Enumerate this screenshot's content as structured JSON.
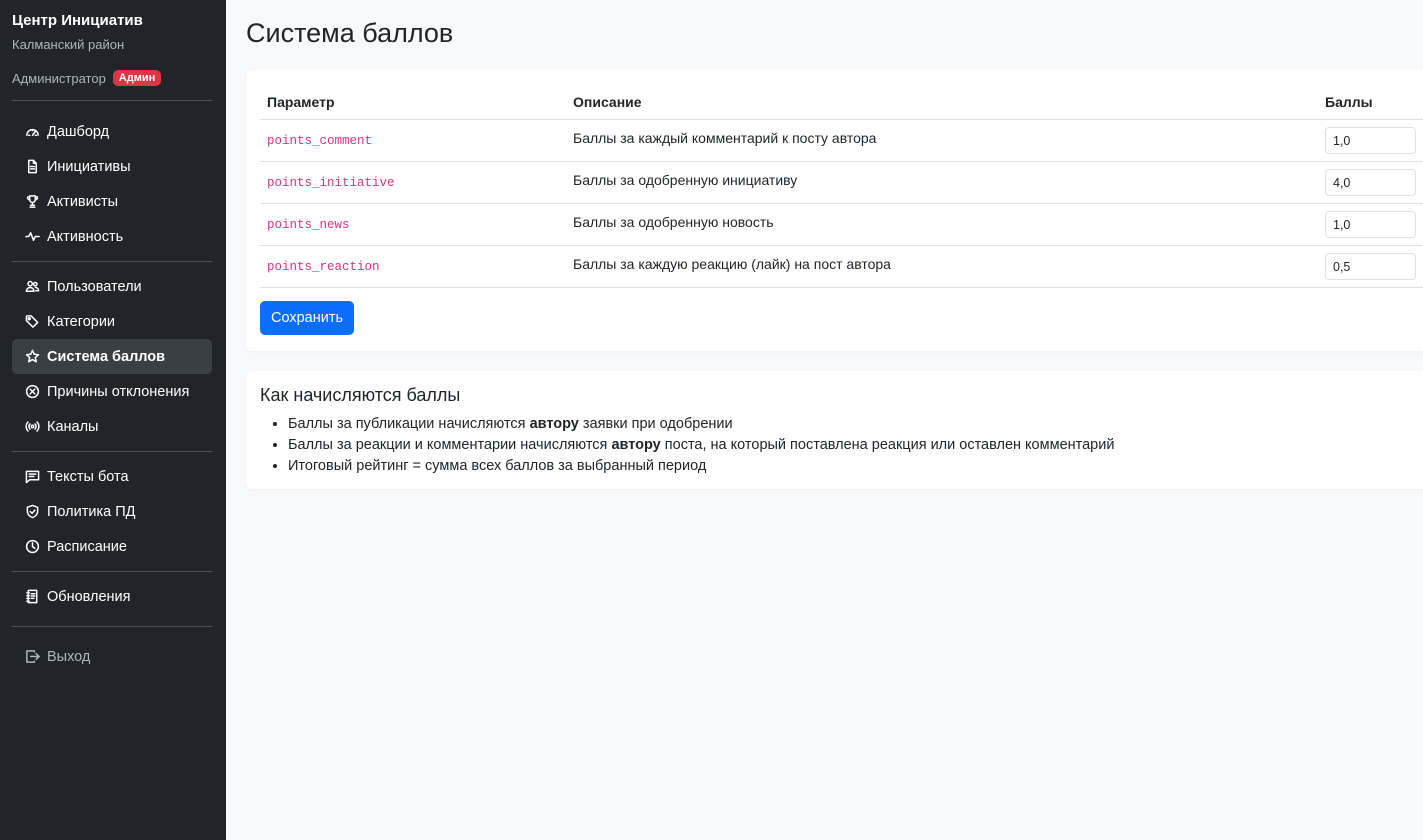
{
  "sidebar": {
    "brand_title": "Центр Инициатив",
    "brand_subtitle": "Калманский район",
    "role_label": "Администратор",
    "role_badge": "Админ",
    "groups": [
      [
        {
          "label": "Дашборд",
          "icon": "speedometer-icon"
        },
        {
          "label": "Инициативы",
          "icon": "document-icon"
        },
        {
          "label": "Активисты",
          "icon": "trophy-icon"
        },
        {
          "label": "Активность",
          "icon": "activity-icon"
        }
      ],
      [
        {
          "label": "Пользователи",
          "icon": "people-icon"
        },
        {
          "label": "Категории",
          "icon": "tags-icon"
        },
        {
          "label": "Система баллов",
          "icon": "star-icon",
          "active": true
        },
        {
          "label": "Причины отклонения",
          "icon": "x-circle-icon"
        },
        {
          "label": "Каналы",
          "icon": "broadcast-icon"
        }
      ],
      [
        {
          "label": "Тексты бота",
          "icon": "chat-icon"
        },
        {
          "label": "Политика ПД",
          "icon": "shield-icon"
        },
        {
          "label": "Расписание",
          "icon": "clock-icon"
        }
      ],
      [
        {
          "label": "Обновления",
          "icon": "journal-icon"
        }
      ]
    ],
    "logout_label": "Выход"
  },
  "main": {
    "page_title": "Система баллов",
    "table": {
      "headers": [
        "Параметр",
        "Описание",
        "Баллы"
      ],
      "rows": [
        {
          "param": "points_comment",
          "description": "Баллы за каждый комментарий к посту автора",
          "value": "1,0"
        },
        {
          "param": "points_initiative",
          "description": "Баллы за одобренную инициативу",
          "value": "4,0"
        },
        {
          "param": "points_news",
          "description": "Баллы за одобренную новость",
          "value": "1,0"
        },
        {
          "param": "points_reaction",
          "description": "Баллы за каждую реакцию (лайк) на пост автора",
          "value": "0,5"
        }
      ]
    },
    "save_label": "Сохранить",
    "info": {
      "title": "Как начисляются баллы",
      "items": [
        {
          "before": "Баллы за публикации начисляются ",
          "bold": "автору",
          "after": " заявки при одобрении"
        },
        {
          "before": "Баллы за реакции и комментарии начисляются ",
          "bold": "автору",
          "after": " поста, на который поставлена реакция или оставлен комментарий"
        },
        {
          "before": "Итоговый рейтинг = сумма всех баллов за выбранный период",
          "bold": "",
          "after": ""
        }
      ]
    }
  },
  "colors": {
    "sidebar_bg": "#212529",
    "accent": "#0d6efd",
    "badge": "#dc3545",
    "code": "#d63384"
  }
}
